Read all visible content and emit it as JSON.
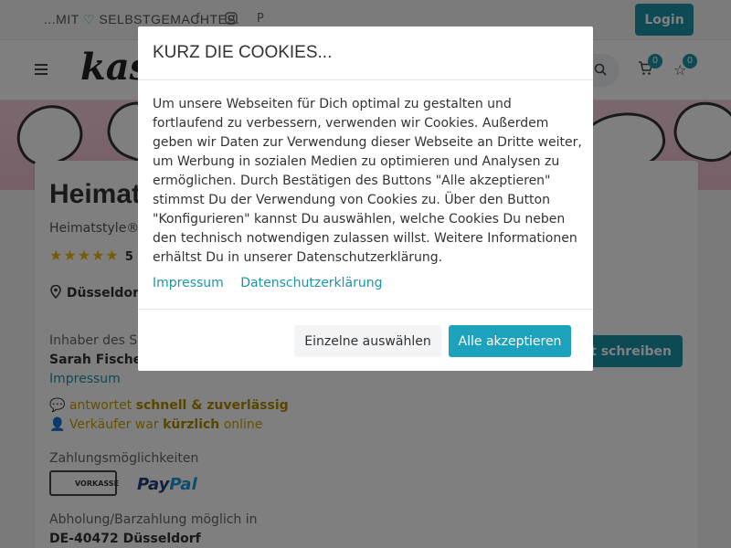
{
  "topbar": {
    "tagline_pre": "...MIT",
    "tagline_post": "SELBSTGEMACHTES.",
    "social_icons": [
      "facebook-icon",
      "instagram-icon",
      "pinterest-icon"
    ],
    "facebook_glyph": "f",
    "pinterest_glyph": "P",
    "login_label": "Login"
  },
  "header": {
    "logo_text": "kasu",
    "cart_count": "0",
    "wishlist_count": "0"
  },
  "shop": {
    "title": "Heimatsty",
    "subtitle": "Heimatstyle® -",
    "rating": "5",
    "location": "Düsseldorf,",
    "owner_label": "Inhaber des Sh",
    "owner_name": "Sarah Fischer",
    "owner_link": "Impressum",
    "response_pre": "antwortet",
    "response_bold": "schnell & zuverlässig",
    "active_pre": "Verkäufer war",
    "active_bold": "kürzlich",
    "active_post": "online",
    "payment_label": "Zahlungsmöglichkeiten",
    "payment_vorkasse": "VORKASSE",
    "payment_paypal_1": "Pay",
    "payment_paypal_2": "Pal",
    "pickup_label": "Abholung/Barzahlung möglich in",
    "pickup_address": "DE-40472 Düsseldorf",
    "message_button": "ht schreiben"
  },
  "cookie_modal": {
    "title": "KURZ DIE COOKIES...",
    "body": "Um unsere Webseiten für Dich optimal zu gestalten und fortlaufend zu verbessern, verwenden wir Cookies. Außerdem geben wir Daten zur Verwendung dieser Webseite an Dritte weiter, um Werbung in sozialen Medien zu optimieren und Analysen zu ermöglichen. Durch Bestätigen des Buttons \"Alle akzeptieren\" stimmst Du der Verwendung von Cookies zu. Über den Button \"Konfigurieren\" kannst Du auswählen, welche Cookies Du neben den technisch notwendigen zulassen willst. Weitere Informationen erhältst Du in unserer Datenschutzerklärung.",
    "link_impressum": "Impressum",
    "link_datenschutz": "Datenschutzerklärung",
    "btn_individual": "Einzelne auswählen",
    "btn_accept": "Alle akzeptieren"
  },
  "colors": {
    "accent": "#1c95a8",
    "accept_button": "#1ca2bd",
    "star": "#f0b90b",
    "banner": "#f3c8d7"
  }
}
